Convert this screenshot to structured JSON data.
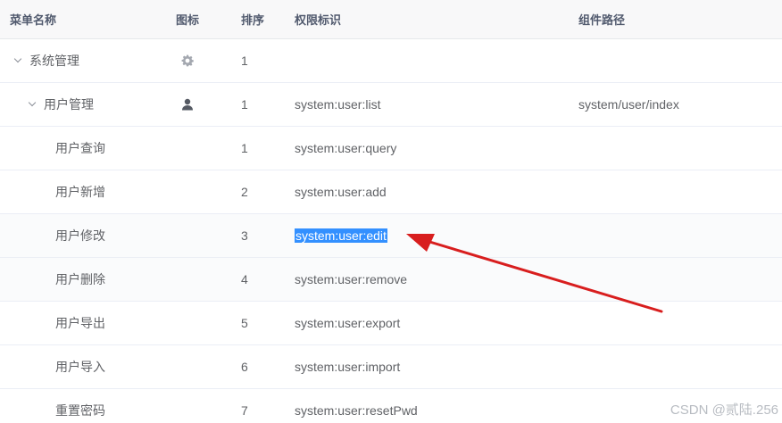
{
  "table": {
    "headers": {
      "name": "菜单名称",
      "icon": "图标",
      "order": "排序",
      "perm": "权限标识",
      "component": "组件路径"
    },
    "rows": [
      {
        "name": "系统管理",
        "icon": "gear-icon",
        "order": "1",
        "perm": "",
        "component": "",
        "expanded": true,
        "level": 0
      },
      {
        "name": "用户管理",
        "icon": "user-icon",
        "order": "1",
        "perm": "system:user:list",
        "component": "system/user/index",
        "expanded": true,
        "level": 1
      },
      {
        "name": "用户查询",
        "icon": "",
        "order": "1",
        "perm": "system:user:query",
        "component": "",
        "level": 2
      },
      {
        "name": "用户新增",
        "icon": "",
        "order": "2",
        "perm": "system:user:add",
        "component": "",
        "level": 2
      },
      {
        "name": "用户修改",
        "icon": "",
        "order": "3",
        "perm": "system:user:edit",
        "component": "",
        "level": 2,
        "text_selected": true
      },
      {
        "name": "用户删除",
        "icon": "",
        "order": "4",
        "perm": "system:user:remove",
        "component": "",
        "level": 2
      },
      {
        "name": "用户导出",
        "icon": "",
        "order": "5",
        "perm": "system:user:export",
        "component": "",
        "level": 2
      },
      {
        "name": "用户导入",
        "icon": "",
        "order": "6",
        "perm": "system:user:import",
        "component": "",
        "level": 2
      },
      {
        "name": "重置密码",
        "icon": "",
        "order": "7",
        "perm": "system:user:resetPwd",
        "component": "",
        "level": 2
      }
    ]
  },
  "annotation": {
    "arrow_color": "#d81e1e",
    "selection_color": "#3390ff"
  },
  "watermark": "CSDN @贰陆.256"
}
